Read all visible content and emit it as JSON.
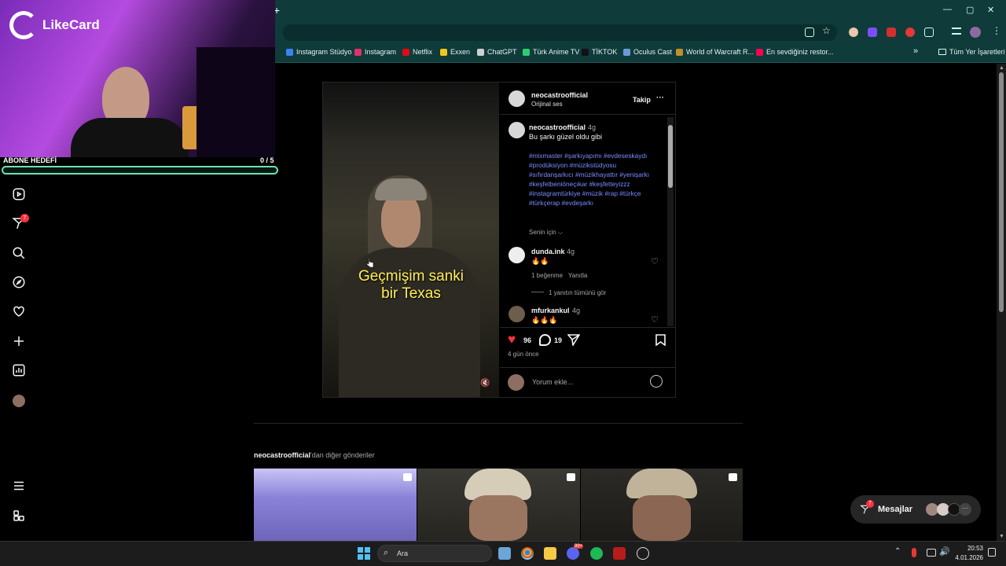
{
  "browser": {
    "new_tab": "+",
    "window_controls": {
      "minimize": "—",
      "maximize": "▢",
      "close": "✕"
    },
    "bookmarks": [
      {
        "label": "Instagram Stüdyo",
        "color": "#3b82f6"
      },
      {
        "label": "Instagram",
        "color": "#e1306c"
      },
      {
        "label": "Netflix",
        "color": "#e50914"
      },
      {
        "label": "Exxen",
        "color": "#f5c518"
      },
      {
        "label": "ChatGPT",
        "color": "#cfcfcf"
      },
      {
        "label": "Türk Anime TV",
        "color": "#2ecc71"
      },
      {
        "label": "TİKTOK",
        "color": "#111111"
      },
      {
        "label": "Oculus Cast",
        "color": "#6c9ad6"
      },
      {
        "label": "World of Warcraft R...",
        "color": "#c0902b"
      },
      {
        "label": "En sevdiğiniz restor...",
        "color": "#fa0050"
      }
    ],
    "bookmarks_overflow": "»",
    "all_bookmarks": "Tüm Yer İşaretleri"
  },
  "stream": {
    "brand": "LikeCard",
    "goal_label": "ABONE HEDEFİ",
    "goal_value": "0  / 5",
    "goal_progress": 0
  },
  "nav": {
    "notification_badge": "7"
  },
  "post": {
    "author": "neocastroofficial",
    "audio": "Orijinal ses",
    "follow": "Takip",
    "more": "···",
    "caption_author": "neocastroofficial",
    "caption_time": "4g",
    "caption_text": "Bu şarkı güzel oldu gibi",
    "hashtags": "#mixmaster #şarkıyapımı #evdeseskaydı #prodüksiyon #müzikstüdyosu #sıfırdanşarkıcı #müzikhayattır #yenişarkı #keşfetbeniöneçıkar #keşfetteyizzz #instagramtürkiye #müzik #rap #türkçe #türkçerap #evdeşarkı",
    "for_you": "Senin için",
    "video_caption_line1": "Geçmişim sanki",
    "video_caption_line2": "bir Texas",
    "comments": [
      {
        "user": "dunda.ink",
        "time": "4g",
        "text": "🔥🔥",
        "likes": "1 beğenme",
        "reply": "Yanıtla",
        "view_replies": "1 yanıtın tümünü gör"
      },
      {
        "user": "mfurkankul",
        "time": "4g",
        "text": "🔥🔥🔥"
      }
    ],
    "like_count": "96",
    "comment_count": "19",
    "posted": "4 gün önce",
    "comment_placeholder": "Yorum ekle..."
  },
  "more_posts": {
    "author": "neocastroofficial",
    "suffix": "'dan diğer gönderiler"
  },
  "messages": {
    "label": "Mesajlar",
    "badge": "7"
  },
  "taskbar": {
    "search": "Ara",
    "time": "20:53",
    "date": "4.01.2026",
    "discord_badge": "99+"
  }
}
